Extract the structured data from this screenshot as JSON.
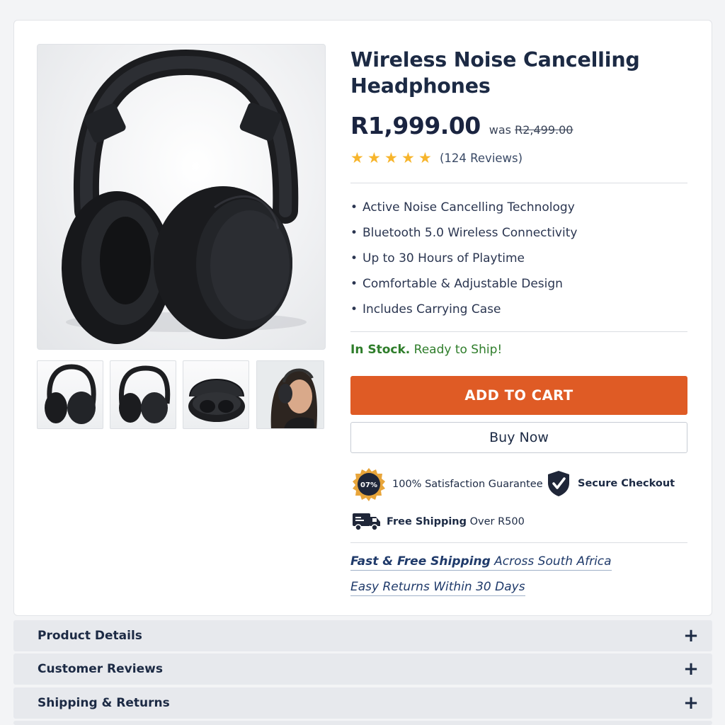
{
  "product": {
    "title_line1": "Wireless Noise Cancelling",
    "title_line2": "Headphones",
    "price": "R1,999.00",
    "was_label": "was",
    "was_price": "R2,499.00",
    "rating": 5,
    "reviews": "(124 Reviews)",
    "features": [
      "Active Noise Cancelling Technology",
      "Bluetooth 5.0 Wireless Connectivity",
      "Up to 30 Hours of Playtime",
      "Comfortable & Adjustable Design",
      "Includes Carrying Case"
    ],
    "stock_status": "In Stock.",
    "stock_note": "Ready to Ship!"
  },
  "gallery": {
    "thumbnails": [
      "headphones-front",
      "headphones-angle",
      "carrying-case",
      "person-wearing"
    ]
  },
  "actions": {
    "add_to_cart": "ADD TO CART",
    "buy_now": "Buy Now"
  },
  "badges": {
    "guarantee_seal": "07%",
    "guarantee": "100% Satisfaction Guarantee",
    "secure": "Secure Checkout",
    "shipping_bold": "Free Shipping",
    "shipping_rest": "Over R500"
  },
  "promos": {
    "shipping_bold": "Fast & Free Shipping",
    "shipping_rest": "Across South Africa",
    "returns": "Easy Returns Within 30 Days"
  },
  "accordions": [
    {
      "label": "Product Details",
      "icon": "+"
    },
    {
      "label": "Customer Reviews",
      "icon": "+"
    },
    {
      "label": "Shipping & Returns",
      "icon": "+"
    }
  ],
  "colors": {
    "accent": "#df5b25",
    "stock": "#2e7d2a",
    "star": "#f7b52c",
    "text": "#1c2a44"
  }
}
